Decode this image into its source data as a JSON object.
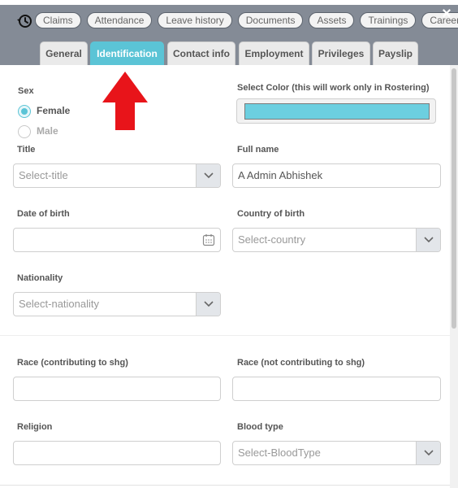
{
  "header": {
    "chips": [
      "Claims",
      "Attendance",
      "Leave history",
      "Documents",
      "Assets",
      "Trainings",
      "Career"
    ],
    "close_symbol": "×",
    "history_icon": "history-clock-icon"
  },
  "tabs": [
    {
      "label": "General",
      "active": false
    },
    {
      "label": "Identification",
      "active": true
    },
    {
      "label": "Contact info",
      "active": false
    },
    {
      "label": "Employment",
      "active": false
    },
    {
      "label": "Privileges",
      "active": false
    },
    {
      "label": "Payslip",
      "active": false
    }
  ],
  "form": {
    "sex_label": "Sex",
    "sex_options": [
      "Female",
      "Male"
    ],
    "sex_selected": "Female",
    "color_label": "Select Color (this will work only in Rostering)",
    "color_value": "#6ccfe0",
    "title_label": "Title",
    "title_placeholder": "Select-title",
    "fullname_label": "Full name",
    "fullname_value": "A Admin Abhishek",
    "dob_label": "Date of birth",
    "dob_value": "",
    "country_label": "Country of birth",
    "country_placeholder": "Select-country",
    "nationality_label": "Nationality",
    "nationality_placeholder": "Select-nationality",
    "race_contrib_label": "Race (contributing to shg)",
    "race_noncontrib_label": "Race (not contributing to shg)",
    "religion_label": "Religion",
    "blood_label": "Blood type",
    "blood_placeholder": "Select-BloodType"
  },
  "colors": {
    "accent": "#5bc4d6",
    "header_bg": "#848b96",
    "arrow": "#e8141a"
  }
}
